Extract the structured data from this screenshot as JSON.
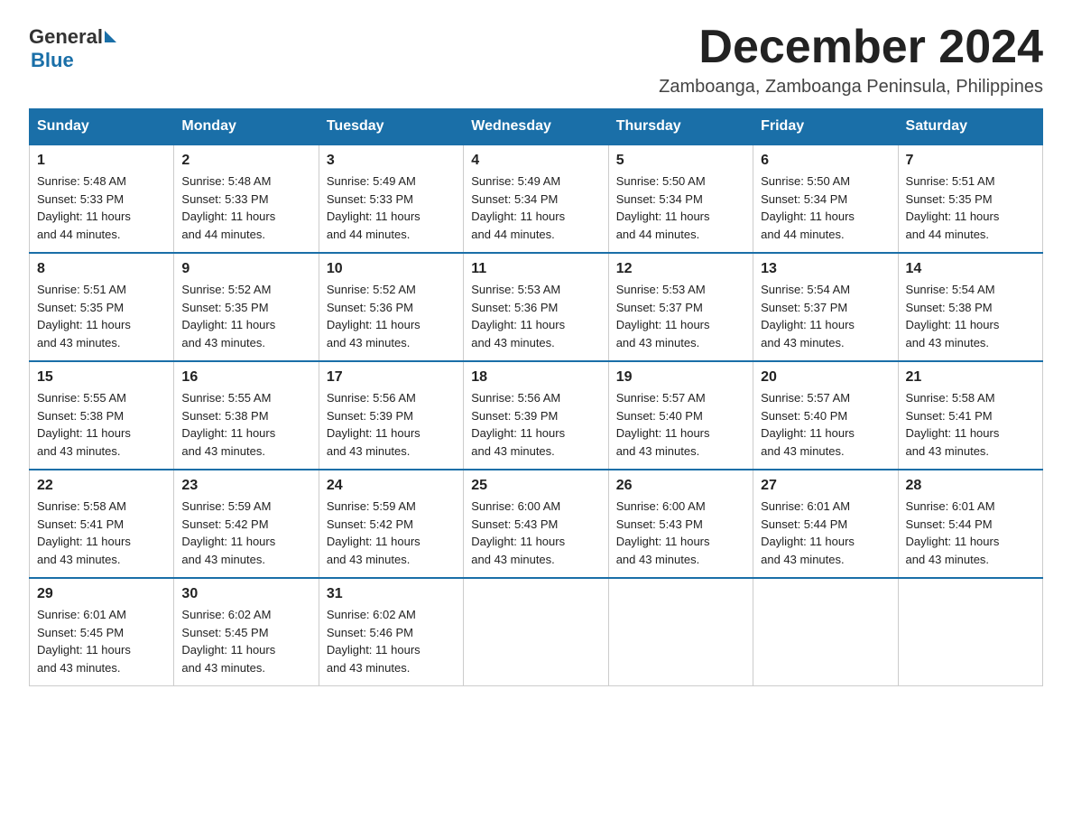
{
  "logo": {
    "text_general": "General",
    "text_blue": "Blue"
  },
  "title": "December 2024",
  "location": "Zamboanga, Zamboanga Peninsula, Philippines",
  "days_of_week": [
    "Sunday",
    "Monday",
    "Tuesday",
    "Wednesday",
    "Thursday",
    "Friday",
    "Saturday"
  ],
  "weeks": [
    [
      {
        "day": "1",
        "sunrise": "5:48 AM",
        "sunset": "5:33 PM",
        "daylight": "11 hours and 44 minutes."
      },
      {
        "day": "2",
        "sunrise": "5:48 AM",
        "sunset": "5:33 PM",
        "daylight": "11 hours and 44 minutes."
      },
      {
        "day": "3",
        "sunrise": "5:49 AM",
        "sunset": "5:33 PM",
        "daylight": "11 hours and 44 minutes."
      },
      {
        "day": "4",
        "sunrise": "5:49 AM",
        "sunset": "5:34 PM",
        "daylight": "11 hours and 44 minutes."
      },
      {
        "day": "5",
        "sunrise": "5:50 AM",
        "sunset": "5:34 PM",
        "daylight": "11 hours and 44 minutes."
      },
      {
        "day": "6",
        "sunrise": "5:50 AM",
        "sunset": "5:34 PM",
        "daylight": "11 hours and 44 minutes."
      },
      {
        "day": "7",
        "sunrise": "5:51 AM",
        "sunset": "5:35 PM",
        "daylight": "11 hours and 44 minutes."
      }
    ],
    [
      {
        "day": "8",
        "sunrise": "5:51 AM",
        "sunset": "5:35 PM",
        "daylight": "11 hours and 43 minutes."
      },
      {
        "day": "9",
        "sunrise": "5:52 AM",
        "sunset": "5:35 PM",
        "daylight": "11 hours and 43 minutes."
      },
      {
        "day": "10",
        "sunrise": "5:52 AM",
        "sunset": "5:36 PM",
        "daylight": "11 hours and 43 minutes."
      },
      {
        "day": "11",
        "sunrise": "5:53 AM",
        "sunset": "5:36 PM",
        "daylight": "11 hours and 43 minutes."
      },
      {
        "day": "12",
        "sunrise": "5:53 AM",
        "sunset": "5:37 PM",
        "daylight": "11 hours and 43 minutes."
      },
      {
        "day": "13",
        "sunrise": "5:54 AM",
        "sunset": "5:37 PM",
        "daylight": "11 hours and 43 minutes."
      },
      {
        "day": "14",
        "sunrise": "5:54 AM",
        "sunset": "5:38 PM",
        "daylight": "11 hours and 43 minutes."
      }
    ],
    [
      {
        "day": "15",
        "sunrise": "5:55 AM",
        "sunset": "5:38 PM",
        "daylight": "11 hours and 43 minutes."
      },
      {
        "day": "16",
        "sunrise": "5:55 AM",
        "sunset": "5:38 PM",
        "daylight": "11 hours and 43 minutes."
      },
      {
        "day": "17",
        "sunrise": "5:56 AM",
        "sunset": "5:39 PM",
        "daylight": "11 hours and 43 minutes."
      },
      {
        "day": "18",
        "sunrise": "5:56 AM",
        "sunset": "5:39 PM",
        "daylight": "11 hours and 43 minutes."
      },
      {
        "day": "19",
        "sunrise": "5:57 AM",
        "sunset": "5:40 PM",
        "daylight": "11 hours and 43 minutes."
      },
      {
        "day": "20",
        "sunrise": "5:57 AM",
        "sunset": "5:40 PM",
        "daylight": "11 hours and 43 minutes."
      },
      {
        "day": "21",
        "sunrise": "5:58 AM",
        "sunset": "5:41 PM",
        "daylight": "11 hours and 43 minutes."
      }
    ],
    [
      {
        "day": "22",
        "sunrise": "5:58 AM",
        "sunset": "5:41 PM",
        "daylight": "11 hours and 43 minutes."
      },
      {
        "day": "23",
        "sunrise": "5:59 AM",
        "sunset": "5:42 PM",
        "daylight": "11 hours and 43 minutes."
      },
      {
        "day": "24",
        "sunrise": "5:59 AM",
        "sunset": "5:42 PM",
        "daylight": "11 hours and 43 minutes."
      },
      {
        "day": "25",
        "sunrise": "6:00 AM",
        "sunset": "5:43 PM",
        "daylight": "11 hours and 43 minutes."
      },
      {
        "day": "26",
        "sunrise": "6:00 AM",
        "sunset": "5:43 PM",
        "daylight": "11 hours and 43 minutes."
      },
      {
        "day": "27",
        "sunrise": "6:01 AM",
        "sunset": "5:44 PM",
        "daylight": "11 hours and 43 minutes."
      },
      {
        "day": "28",
        "sunrise": "6:01 AM",
        "sunset": "5:44 PM",
        "daylight": "11 hours and 43 minutes."
      }
    ],
    [
      {
        "day": "29",
        "sunrise": "6:01 AM",
        "sunset": "5:45 PM",
        "daylight": "11 hours and 43 minutes."
      },
      {
        "day": "30",
        "sunrise": "6:02 AM",
        "sunset": "5:45 PM",
        "daylight": "11 hours and 43 minutes."
      },
      {
        "day": "31",
        "sunrise": "6:02 AM",
        "sunset": "5:46 PM",
        "daylight": "11 hours and 43 minutes."
      },
      null,
      null,
      null,
      null
    ]
  ],
  "labels": {
    "sunrise": "Sunrise:",
    "sunset": "Sunset:",
    "daylight": "Daylight:"
  },
  "colors": {
    "header_bg": "#1a6fa8",
    "header_text": "#ffffff",
    "border_top": "#1a6fa8"
  }
}
